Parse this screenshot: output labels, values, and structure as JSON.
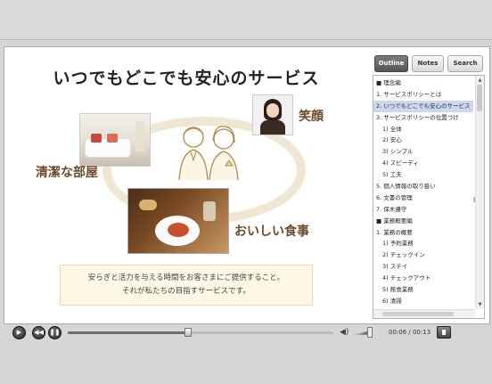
{
  "slide": {
    "title": "いつでもどこでも安心のサービス",
    "labels": {
      "smile": "笑顔",
      "clean_room": "清潔な部屋",
      "tasty_food": "おいしい食事"
    },
    "message": {
      "line1": "安らぎと活力を与える時間をお客さまにご提供すること。",
      "line2": "それが私たちの目指すサービスです。"
    }
  },
  "side_panel": {
    "tabs": [
      {
        "label": "Outline",
        "active": true
      },
      {
        "label": "Notes",
        "active": false
      },
      {
        "label": "Search",
        "active": false
      }
    ],
    "outline_items": [
      {
        "label": "■ 理念編",
        "indent": false,
        "selected": false
      },
      {
        "label": "1. サービスポリシーとは",
        "indent": false,
        "selected": false
      },
      {
        "label": "2. いつでもどこでも安心のサービス",
        "indent": false,
        "selected": true
      },
      {
        "label": "3. サービスポリシーの位置づけ",
        "indent": false,
        "selected": false
      },
      {
        "label": "1) 全体",
        "indent": true,
        "selected": false
      },
      {
        "label": "2) 安心",
        "indent": true,
        "selected": false
      },
      {
        "label": "3) シンプル",
        "indent": true,
        "selected": false
      },
      {
        "label": "4) スピーディ",
        "indent": true,
        "selected": false
      },
      {
        "label": "5) 工夫",
        "indent": true,
        "selected": false
      },
      {
        "label": "5. 個人情報の取り扱い",
        "indent": false,
        "selected": false
      },
      {
        "label": "6. 文書の管理",
        "indent": false,
        "selected": false
      },
      {
        "label": "7. 保木遵守",
        "indent": false,
        "selected": false
      },
      {
        "label": "■ 業務概要編",
        "indent": false,
        "selected": false
      },
      {
        "label": "1. 業務の概要",
        "indent": false,
        "selected": false
      },
      {
        "label": "1) 予約業務",
        "indent": true,
        "selected": false
      },
      {
        "label": "2) チェックイン",
        "indent": true,
        "selected": false
      },
      {
        "label": "3) ステイ",
        "indent": true,
        "selected": false
      },
      {
        "label": "4) チェックアウト",
        "indent": true,
        "selected": false
      },
      {
        "label": "5) 館食業務",
        "indent": true,
        "selected": false
      },
      {
        "label": "6) 清掃",
        "indent": true,
        "selected": false
      }
    ],
    "edge_mark": "ξ"
  },
  "player": {
    "time": "00:06 / 00:13",
    "progress_fraction": 0.46,
    "volume_fraction": 0.85,
    "icons": [
      "play-icon",
      "rewind-icon",
      "pause-icon",
      "volume-icon",
      "menu-icon"
    ]
  }
}
